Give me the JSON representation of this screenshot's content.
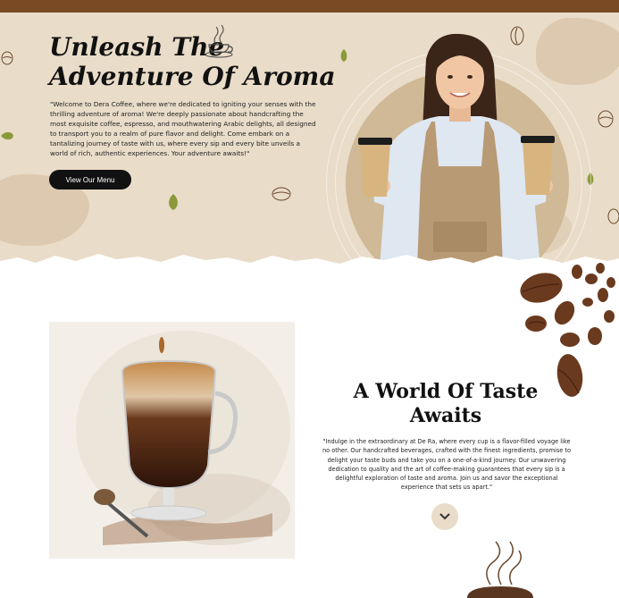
{
  "hero": {
    "title_line1": "Unleash The",
    "title_line2": "Adventure Of Aroma",
    "description": "\"Welcome to Dera Coffee, where we're dedicated to igniting your senses with the thrilling adventure of aroma! We're deeply passionate about handcrafting the most exquisite coffee, espresso, and mouthwatering Arabic delights, all designed to transport you to a realm of pure flavor and delight. Come embark on a tantalizing journey of taste with us, where every sip and every bite unveils a world of rich, authentic experiences. Your adventure awaits!\"",
    "menu_button": "View Our Menu"
  },
  "section": {
    "title_line1": "A World Of Taste",
    "title_line2": "Awaits",
    "description": "\"Indulge in the extraordinary at De Ra, where every cup is a flavor-filled voyage like no other. Our handcrafted beverages, crafted with the finest ingredients, promise to delight your taste buds and take you on a one-of-a-kind journey. Our unwavering dedication to quality and the art of coffee-making guarantees that every sip is a delightful exploration of taste and aroma. Join us and savor the exceptional experience that sets us apart.\""
  },
  "colors": {
    "hero_bg": "#e9dcc8",
    "top_band": "#7a4a25",
    "leaf": "#8a9a3a",
    "button": "#111111",
    "down_button": "#e9dcc8"
  },
  "icons": {
    "scroll_button": "chevron-down-icon",
    "cup_sketch": "coffee-cup-sketch-icon",
    "bean": "coffee-bean-icon",
    "leaf": "leaf-icon"
  }
}
